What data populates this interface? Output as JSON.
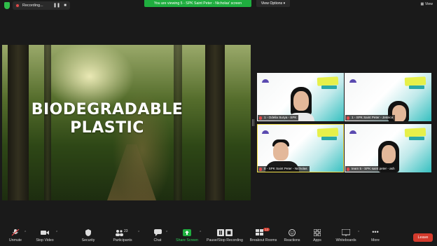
{
  "topbar": {
    "recording_label": "Recording...",
    "pause_icon": "pause-icon",
    "stop_icon": "stop-icon",
    "viewing_banner": "You are viewing 5 - SPK Saint Peter - Nicholas' screen",
    "view_options": "View Options",
    "view_button": "View",
    "accent_green": "#1fae3f"
  },
  "slide": {
    "title_line1": "BIODEGRADABLE",
    "title_line2": "PLASTIC"
  },
  "gallery": [
    {
      "name": "1 - Odelia Surya - SPK"
    },
    {
      "name": "1 - SPK Saint Peter - Jessica"
    },
    {
      "name": "5 - SPK Saint Peter - Nicholas"
    },
    {
      "name": "team 5 - SPK saint peter - ash"
    }
  ],
  "toolbar": {
    "items": [
      {
        "label": "Unmute",
        "icon": "mic-muted-icon"
      },
      {
        "label": "Stop Video",
        "icon": "video-camera-icon"
      },
      {
        "label": "Security",
        "icon": "shield-icon"
      },
      {
        "label": "Participants",
        "icon": "participants-icon",
        "count": "23"
      },
      {
        "label": "Chat",
        "icon": "chat-icon"
      },
      {
        "label": "Share Screen",
        "icon": "share-screen-icon"
      },
      {
        "label": "Pause/Stop Recording",
        "icon": "recording-controls-icon"
      },
      {
        "label": "Breakout Rooms",
        "icon": "breakout-rooms-icon",
        "count": "14"
      },
      {
        "label": "Reactions",
        "icon": "reactions-icon"
      },
      {
        "label": "Apps",
        "icon": "apps-icon"
      },
      {
        "label": "Whiteboards",
        "icon": "whiteboard-icon"
      },
      {
        "label": "More",
        "icon": "more-icon"
      }
    ],
    "leave_label": "Leave",
    "leave_color": "#d33a2c"
  }
}
